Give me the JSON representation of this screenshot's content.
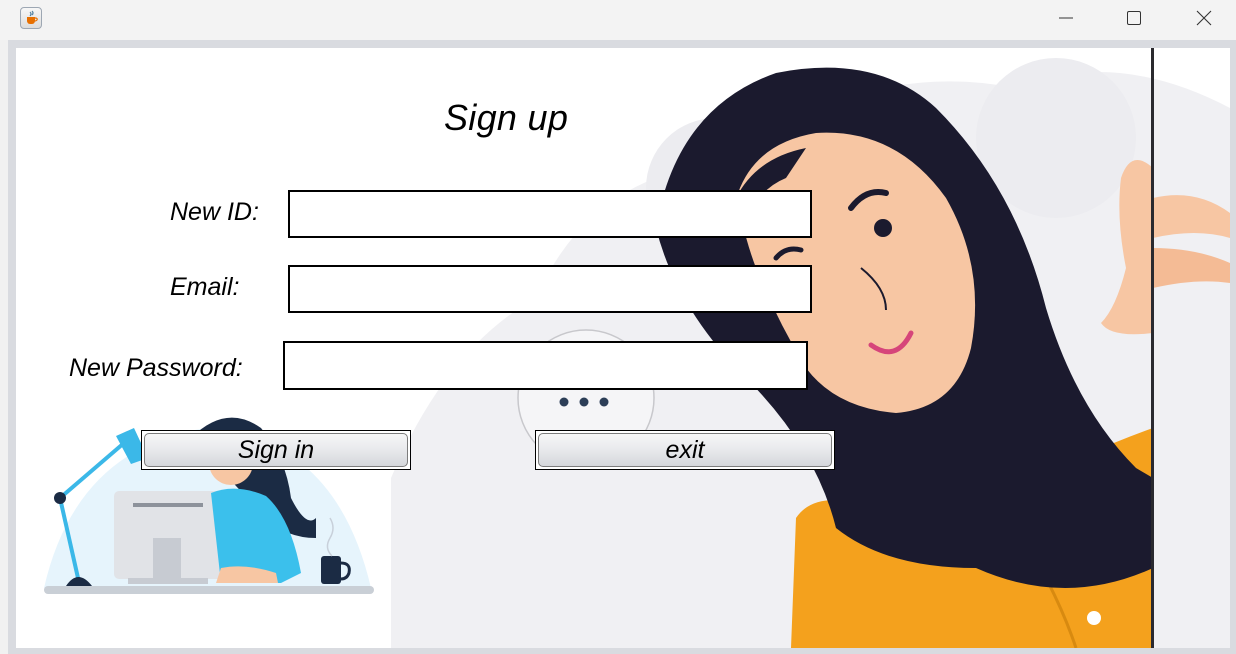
{
  "window": {
    "icon": "java-cup-icon",
    "controls": [
      "minimize-icon",
      "maximize-icon",
      "close-icon"
    ]
  },
  "form": {
    "title": "Sign up",
    "id_label": "New ID:",
    "id_value": "",
    "email_label": "Email:",
    "email_value": "",
    "password_label": "New Password:",
    "password_value": "",
    "signin_label": "Sign in",
    "exit_label": "exit"
  },
  "colors": {
    "hijab": "#1b1a2e",
    "skin": "#f7c6a3",
    "shirt": "#f4a11d",
    "accent_blue": "#3bb8e8"
  }
}
